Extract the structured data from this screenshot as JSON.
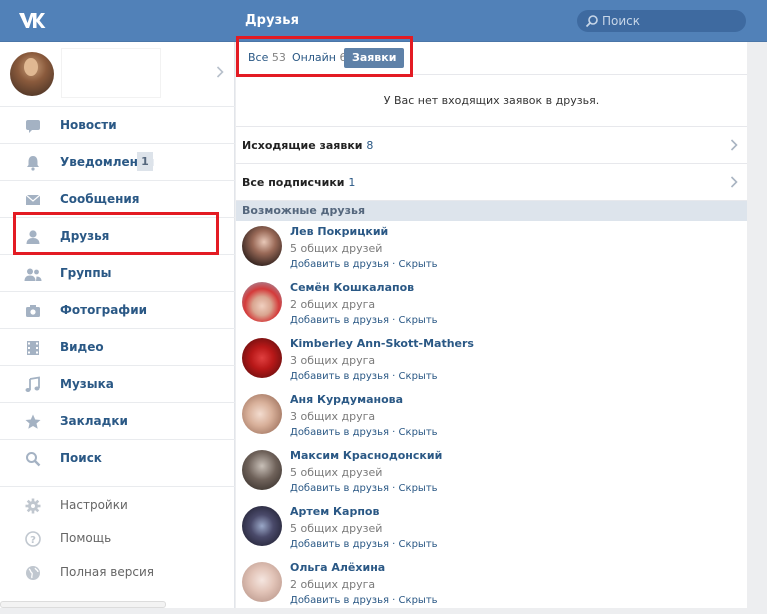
{
  "header": {
    "title": "Друзья",
    "search_placeholder": "Поиск",
    "logo_icon": "vk-logo-icon",
    "colors": {
      "bar": "#5181b8",
      "search": "#3e6aa0"
    }
  },
  "sidebar": {
    "items": [
      {
        "label": "Новости",
        "icon": "news-icon"
      },
      {
        "label": "Уведомления",
        "icon": "bell-icon",
        "badge": "1"
      },
      {
        "label": "Сообщения",
        "icon": "envelope-icon"
      },
      {
        "label": "Друзья",
        "icon": "person-icon"
      },
      {
        "label": "Группы",
        "icon": "people-icon"
      },
      {
        "label": "Фотографии",
        "icon": "camera-icon"
      },
      {
        "label": "Видео",
        "icon": "film-icon"
      },
      {
        "label": "Музыка",
        "icon": "music-note-icon"
      },
      {
        "label": "Закладки",
        "icon": "star-icon"
      },
      {
        "label": "Поиск",
        "icon": "search-icon"
      }
    ],
    "secondary": [
      {
        "label": "Настройки",
        "icon": "gear-icon"
      },
      {
        "label": "Помощь",
        "icon": "help-icon"
      },
      {
        "label": "Полная версия",
        "icon": "globe-icon"
      }
    ]
  },
  "tabs": {
    "all_label": "Все",
    "all_count": "53",
    "online_label": "Онлайн",
    "online_count": "6",
    "requests_label": "Заявки"
  },
  "requests": {
    "empty_message": "У Вас нет входящих заявок в друзья.",
    "outgoing_label": "Исходящие заявки",
    "outgoing_count": "8",
    "subscribers_label": "Все подписчики",
    "subscribers_count": "1"
  },
  "suggestions": {
    "title": "Возможные друзья",
    "add_label": "Добавить в друзья",
    "separator": " · ",
    "hide_label": "Скрыть",
    "people": [
      {
        "name": "Лев Покрицкий",
        "mutual": "5 общих друзей"
      },
      {
        "name": "Семён Кошкалапов",
        "mutual": "2 общих друга"
      },
      {
        "name": "Kimberley Ann-Skott-Mathers",
        "mutual": "3 общих друга"
      },
      {
        "name": "Аня Курдуманова",
        "mutual": "3 общих друга"
      },
      {
        "name": "Максим Краснодонский",
        "mutual": "5 общих друзей"
      },
      {
        "name": "Артем Карпов",
        "mutual": "5 общих друзей"
      },
      {
        "name": "Ольга Алёхина",
        "mutual": "2 общих друга"
      }
    ]
  }
}
